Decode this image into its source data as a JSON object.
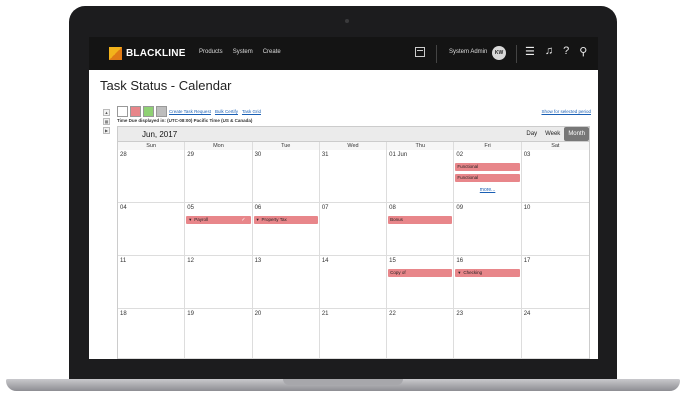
{
  "app": {
    "brand": "BLACKLINE",
    "nav": [
      "Products",
      "System",
      "Create"
    ],
    "user_name": "System Admin",
    "user_initials": "KW",
    "top_icons": [
      "list-icon",
      "bell-icon",
      "help-icon",
      "search-icon"
    ]
  },
  "page": {
    "title": "Task Status - Calendar",
    "links": [
      "Create Task Request",
      "Bulk Certify",
      "Task Grid"
    ],
    "timezone": "Time Due displayed in: (UTC-08:00) Pacific Time (US & Canada)",
    "show_for": "Show for selected period",
    "swatch_colors": [
      "#ffffff",
      "#e8868a",
      "#8fd174",
      "#bdbdbd"
    ]
  },
  "calendar": {
    "month_label": "Jun, 2017",
    "views": [
      "Day",
      "Week",
      "Month"
    ],
    "active_view": "Month",
    "weekdays": [
      "Sun",
      "Mon",
      "Tue",
      "Wed",
      "Thu",
      "Fri",
      "Sat"
    ],
    "weeks": [
      [
        "28",
        "29",
        "30",
        "31",
        "01 Jun",
        "02",
        "03"
      ],
      [
        "04",
        "05",
        "06",
        "07",
        "08",
        "09",
        "10"
      ],
      [
        "11",
        "12",
        "13",
        "14",
        "15",
        "16",
        "17"
      ],
      [
        "18",
        "19",
        "20",
        "21",
        "22",
        "23",
        "24"
      ]
    ],
    "events": {
      "e1": "Functional",
      "e2": "Functional",
      "e3": "Payroll",
      "e4": "Property Tax",
      "e5": "Bonus",
      "e6": "Copy of",
      "e7": "Checking"
    },
    "more_label": "more...",
    "event_color": "#e8868a"
  }
}
